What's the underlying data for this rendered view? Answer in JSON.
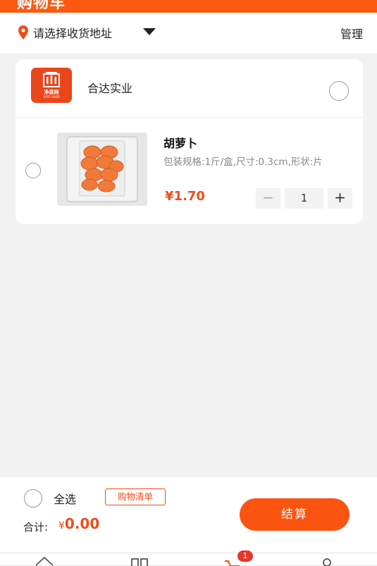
{
  "header": {
    "title": "购物车"
  },
  "address": {
    "label": "请选择收货地址",
    "manage_label": "管理"
  },
  "store": {
    "name": "合达实业",
    "logo": {
      "text": "净菜网",
      "subtext": "SAFE FOOD"
    }
  },
  "items": [
    {
      "name": "胡萝卜",
      "spec": "包装规格:1斤/盒,尺寸:0.3cm,形状:片",
      "price": "¥1.70",
      "quantity": "1",
      "checked": false
    }
  ],
  "stepper": {
    "minus": "−",
    "plus": "+"
  },
  "footer": {
    "select_all_label": "全选",
    "shopping_list_label": "购物清单",
    "total_label": "合计:",
    "total_currency": "¥",
    "total_value": "0.00",
    "checkout_label": "结算"
  },
  "tabbar": {
    "cart_badge": "1",
    "icons": [
      "home-icon",
      "category-icon",
      "cart-icon",
      "profile-icon"
    ]
  },
  "colors": {
    "accent": "#fb5a10",
    "price": "#ee4d1a",
    "badge": "#e8352a"
  }
}
